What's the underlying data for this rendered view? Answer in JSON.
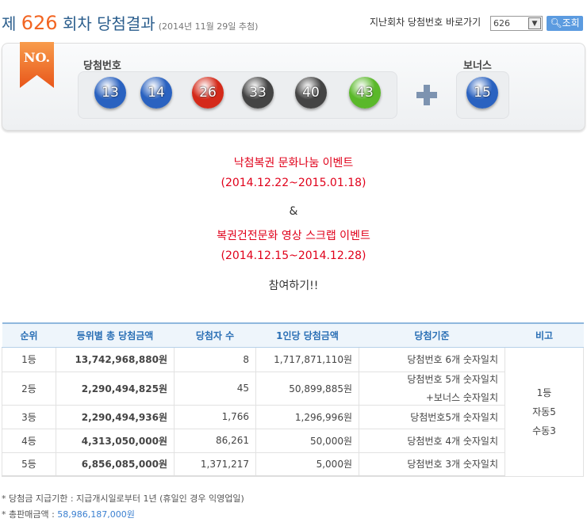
{
  "header": {
    "prefix": "제",
    "draw_no": "626",
    "suffix": "회차 당첨결과",
    "date": "(2014년 11월 29일 추첨)",
    "goto_label": "지난회차 당첨번호 바로가기",
    "select_value": "626",
    "search_button": "조회"
  },
  "result": {
    "ribbon": "NO.",
    "numbers_label": "당첨번호",
    "bonus_label": "보너스",
    "numbers": [
      {
        "n": "13",
        "color": "#2a62c0"
      },
      {
        "n": "14",
        "color": "#2a62c0"
      },
      {
        "n": "26",
        "color": "#d42a1a"
      },
      {
        "n": "33",
        "color": "#444444"
      },
      {
        "n": "40",
        "color": "#444444"
      },
      {
        "n": "43",
        "color": "#5ab82a"
      }
    ],
    "bonus": {
      "n": "15",
      "color": "#2a62c0"
    }
  },
  "event": {
    "line1": "낙첨복권 문화나눔 이벤트",
    "line2": "(2014.12.22~2015.01.18)",
    "amp": "&",
    "line3": "복권건전문화 영상 스크랩 이벤트",
    "line4": "(2014.12.15~2014.12.28)",
    "join": "참여하기!!"
  },
  "table": {
    "headers": [
      "순위",
      "등위별 총 당첨금액",
      "당첨자 수",
      "1인당 당첨금액",
      "당첨기준",
      "비고"
    ],
    "rows": [
      {
        "rank": "1등",
        "total": "13,742,968,880원",
        "winners": "8",
        "per": "1,717,871,110원",
        "criteria": "당첨번호 6개 숫자일치",
        "criteria2": ""
      },
      {
        "rank": "2등",
        "total": "2,290,494,825원",
        "winners": "45",
        "per": "50,899,885원",
        "criteria": "당첨번호 5개 숫자일치",
        "criteria2": "+보너스 숫자일치"
      },
      {
        "rank": "3등",
        "total": "2,290,494,936원",
        "winners": "1,766",
        "per": "1,296,996원",
        "criteria": "당첨번호5개 숫자일치",
        "criteria2": ""
      },
      {
        "rank": "4등",
        "total": "4,313,050,000원",
        "winners": "86,261",
        "per": "50,000원",
        "criteria": "당첨번호 4개 숫자일치",
        "criteria2": ""
      },
      {
        "rank": "5등",
        "total": "6,856,085,000원",
        "winners": "1,371,217",
        "per": "5,000원",
        "criteria": "당첨번호 3개 숫자일치",
        "criteria2": ""
      }
    ],
    "note": [
      "1등",
      "자동5",
      "수동3"
    ]
  },
  "footer": {
    "line1": "* 당첨금 지급기한 : 지급개시일로부터 1년 (휴일인 경우 익영업일)",
    "line2_label": "* 총판매금액 : ",
    "line2_value": "58,986,187,000원"
  }
}
